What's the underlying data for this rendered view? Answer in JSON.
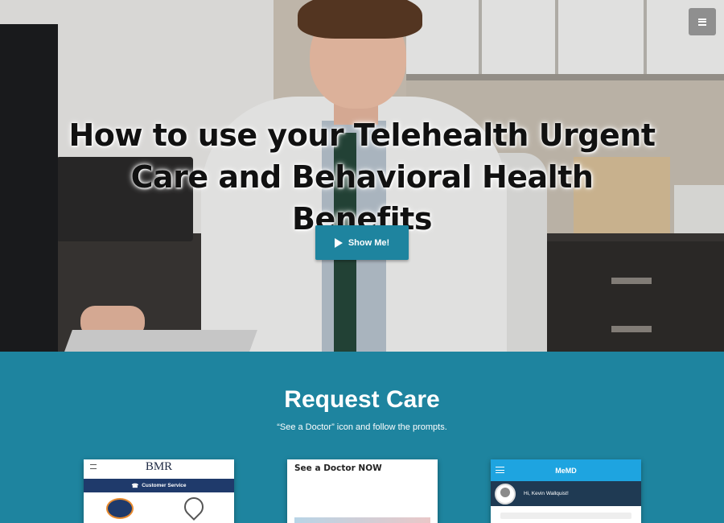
{
  "hero": {
    "title": "How to use your Telehealth Urgent Care and Behavioral Health Benefits",
    "button_label": "Show Me!",
    "button_icon": "play-icon"
  },
  "nav": {
    "menu_icon": "hamburger-icon"
  },
  "section": {
    "title": "Request Care",
    "subtitle": "“See a Doctor” icon and follow the prompts."
  },
  "phones": {
    "one": {
      "brand": "BMR",
      "bar_label": "Customer Service"
    },
    "two": {
      "title": "See a Doctor NOW"
    },
    "three": {
      "brand": "MeMD",
      "greeting": "Hi, Kevin Wallquist!"
    }
  },
  "colors": {
    "accent": "#1e849f",
    "menu_button": "#8f8f8f",
    "bmr_bar": "#1f3a6b",
    "memd_header": "#1ea4e0"
  }
}
